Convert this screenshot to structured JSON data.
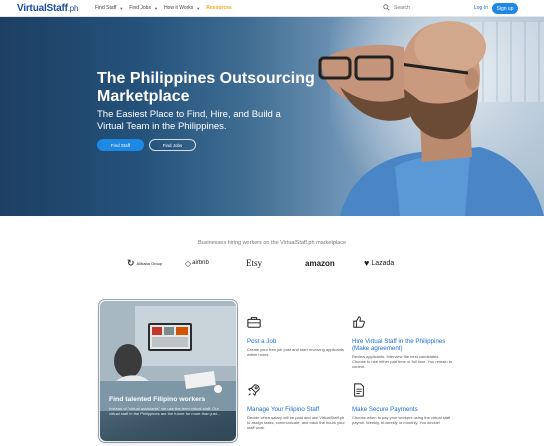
{
  "nav": {
    "logo_main": "VirtualStaff",
    "logo_suffix": ".ph",
    "items": [
      {
        "label": "Find Staff"
      },
      {
        "label": "Find Jobs"
      },
      {
        "label": "How it Works"
      }
    ],
    "highlight": "Resources",
    "search_placeholder": "Search",
    "login": "Log In",
    "signup": "Sign up"
  },
  "hero": {
    "title": "The Philippines Outsourcing Marketplace",
    "subtitle": "The Easiest Place to Find, Hire, and Build a Virtual Team in the Philippines.",
    "primary_button": "Find Staff",
    "secondary_button": "Find Jobs"
  },
  "brands": {
    "title": "Businesses hiring workers on the VirtualStaff.ph marketplace",
    "items": [
      "Alibaba Group",
      "airbnb",
      "Etsy",
      "amazon",
      "Lazada"
    ]
  },
  "feature_card": {
    "title": "Find talented Filipino workers",
    "desc": "Instead of \"virtual assistants\" we use the term virtual staff. Our virtual staff in the Philippines are the future for more than just..."
  },
  "features": [
    {
      "title": "Post a Job",
      "desc": "Create your free job post and start receiving applicants within hours.",
      "icon": "briefcase-icon"
    },
    {
      "title": "Hire Virtual Staff in the Philippines (Make agreement)",
      "desc": "Review applicants. Interview the best candidates. Choose to hire either part time or full time. You remain in control.",
      "icon": "thumbs-up-icon"
    },
    {
      "title": "Manage Your Filipino Staff",
      "desc": "Decide when salary will be paid and use VirtualStaff.ph to assign tasks, communicate, and track the hours your staff work.",
      "icon": "rocket-icon"
    },
    {
      "title": "Make Secure Payments",
      "desc": "Choose when to pay your workers using the virtual staff payroll. Weekly, bi-weekly or monthly. You decide!",
      "icon": "document-icon"
    }
  ],
  "colors": {
    "brand": "#1a4fa3",
    "accent": "#1e88e5",
    "highlight": "#f5a623"
  }
}
